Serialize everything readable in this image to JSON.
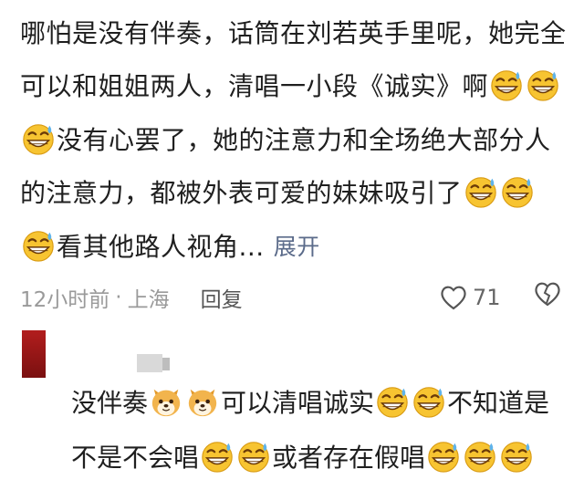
{
  "comment1": {
    "line1": "哪怕是没有伴奏，话筒在刘若英手里呢，她完全",
    "line2_text": "可以和姐姐两人，清唱一小段《诚实》啊",
    "line3_text": "没有心罢了，她的注意力和全场绝大部分人",
    "line4_text": "的注意力，都被外表可爱的妹妹吸引了",
    "line5_text": "看其他路人视角...",
    "expand_label": "展开",
    "time": "12小时前",
    "location": "上海",
    "reply_label": "回复",
    "likes": "71",
    "emoji": "grin-sweat-icon"
  },
  "comment2": {
    "part1": "没伴奏",
    "part2": "可以清唱诚实",
    "part3": "不知道是",
    "line2_part1": "不是不会唱",
    "line2_part2": "或者存在假唱",
    "emoji_dog": "shiba-dog-icon",
    "emoji_grin": "grin-sweat-icon"
  }
}
